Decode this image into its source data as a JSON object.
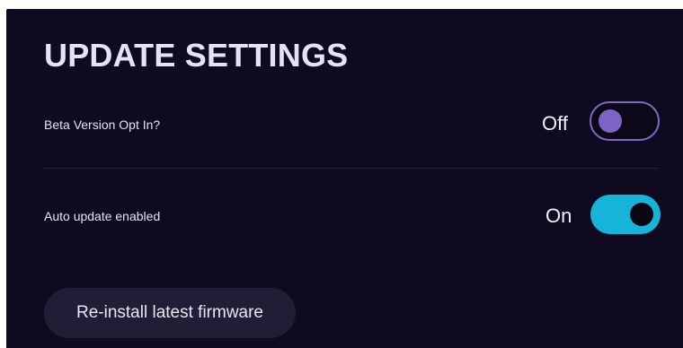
{
  "section": {
    "title": "UPDATE SETTINGS"
  },
  "settings": [
    {
      "label": "Beta Version Opt In?",
      "state_text": "Off",
      "enabled": false
    },
    {
      "label": "Auto update enabled",
      "state_text": "On",
      "enabled": true
    }
  ],
  "actions": {
    "reinstall_label": "Re-install latest firmware"
  },
  "colors": {
    "panel_background": "#100a21",
    "toggle_on_track": "#15b4d8",
    "toggle_off_knob": "#7d64c9",
    "toggle_off_border": "#7b6cc2",
    "button_background": "#231c36",
    "text": "#e6e1f4"
  }
}
